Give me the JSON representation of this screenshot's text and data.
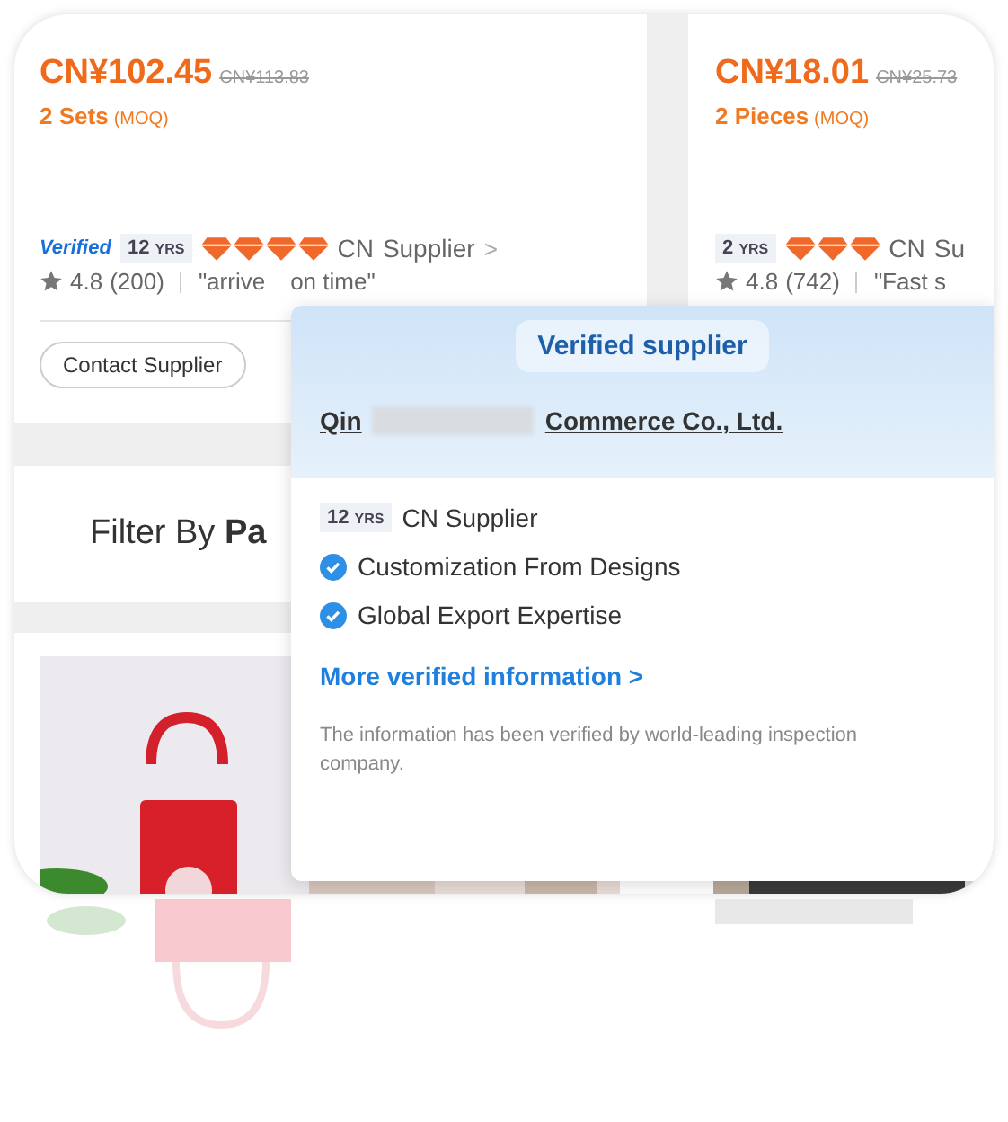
{
  "products": [
    {
      "price": "CN¥102.45",
      "original_price": "CN¥113.83",
      "moq_qty": "2 Sets",
      "moq_label": "(MOQ)",
      "verified": true,
      "verified_label": "Verified",
      "years": "12",
      "years_unit": "YRS",
      "stars": 4,
      "origin": "CN",
      "supplier_type": "Supplier",
      "chevron": ">",
      "rating": "4.8",
      "reviews": "(200)",
      "quote_start": "\"arrive",
      "quote_end": "on time\"",
      "contact_button": "Contact Supplier"
    },
    {
      "price": "CN¥18.01",
      "original_price": "CN¥25.73",
      "moq_qty": "2 Pieces",
      "moq_label": "(MOQ)",
      "verified": false,
      "years": "2",
      "years_unit": "YRS",
      "stars": 3,
      "origin": "CN",
      "supplier_type": "Su",
      "rating": "4.8",
      "reviews": "(742)",
      "quote_start": "\"Fast s"
    }
  ],
  "filter": {
    "label": "Filter By **Pa**"
  },
  "popover": {
    "title": "Verified supplier",
    "company_start": "Qin",
    "company_end": "Commerce Co., Ltd.",
    "years": "12",
    "years_unit": "YRS",
    "supplier": "CN Supplier",
    "features": [
      "Customization From Designs",
      "Global Export Expertise"
    ],
    "link": "More verified information >",
    "note": "The information has been verified by world-leading inspection company."
  }
}
